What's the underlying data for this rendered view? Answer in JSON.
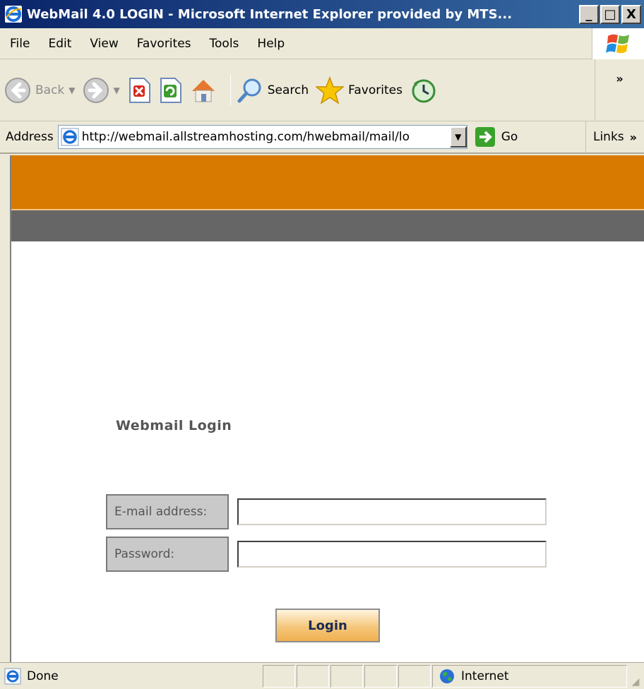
{
  "window": {
    "title": "WebMail 4.0 LOGIN - Microsoft Internet Explorer provided by MTS...",
    "minimize": "_",
    "maximize": "□",
    "close": "X"
  },
  "menu": {
    "items": [
      "File",
      "Edit",
      "View",
      "Favorites",
      "Tools",
      "Help"
    ]
  },
  "toolbar": {
    "back_label": "Back",
    "search_label": "Search",
    "favorites_label": "Favorites",
    "overflow": "»"
  },
  "address": {
    "label": "Address",
    "url": "http://webmail.allstreamhosting.com/hwebmail/mail/lo",
    "go_label": "Go",
    "links_label": "Links",
    "links_overflow": "»"
  },
  "page": {
    "heading": "Webmail Login",
    "email_label": "E-mail address:",
    "email_value": "",
    "password_label": "Password:",
    "password_value": "",
    "login_button": "Login",
    "colors": {
      "orange_band": "#d97a00",
      "gray_band": "#666666"
    }
  },
  "status": {
    "text": "Done",
    "zone": "Internet"
  }
}
